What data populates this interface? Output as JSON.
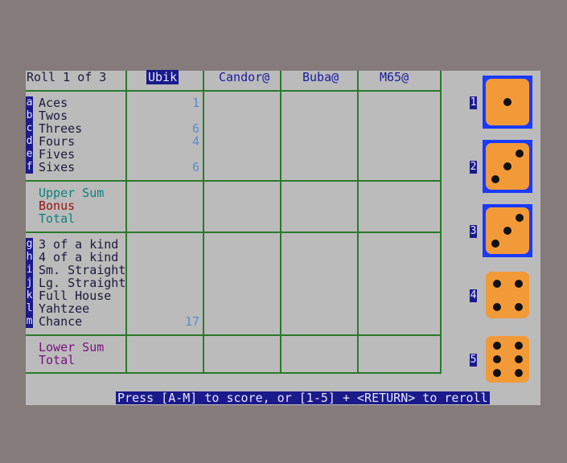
{
  "roll_label": "Roll 1 of 3",
  "players": [
    "Ubik",
    "Candor@",
    "Buba@",
    "M65@"
  ],
  "upper_keys": [
    "a",
    "b",
    "c",
    "d",
    "e",
    "f"
  ],
  "upper_labels": [
    "Aces",
    "Twos",
    "Threes",
    "Fours",
    "Fives",
    "Sixes"
  ],
  "upper_sum_label": "Upper Sum",
  "bonus_label": "Bonus",
  "upper_total_label": "Total",
  "lower_keys": [
    "g",
    "h",
    "i",
    "j",
    "k",
    "l",
    "m"
  ],
  "lower_labels": [
    "3 of a kind",
    "4 of a kind",
    "Sm. Straight",
    "Lg. Straight",
    "Full House",
    "Yahtzee",
    "Chance"
  ],
  "lower_sum_label": "Lower Sum",
  "lower_total_label": "Total",
  "scores_ubik": {
    "aces": "1",
    "threes": "6",
    "fours": "4",
    "sixes": "6",
    "chance": "17"
  },
  "dice": [
    {
      "num": "1",
      "value": 1,
      "held": true
    },
    {
      "num": "2",
      "value": 3,
      "held": true
    },
    {
      "num": "3",
      "value": 3,
      "held": true
    },
    {
      "num": "4",
      "value": 4,
      "held": false
    },
    {
      "num": "5",
      "value": 6,
      "held": false
    }
  ],
  "status_text": "Press [A-M] to score, or [1-5] + <RETURN> to reroll",
  "colors": {
    "background": "#857b7b",
    "screen": "#bbbbbb",
    "grid": "#2a7a2a",
    "die_face": "#f39a38",
    "die_held_frame": "#1a3aff",
    "key_bg": "#1a1a8a"
  }
}
